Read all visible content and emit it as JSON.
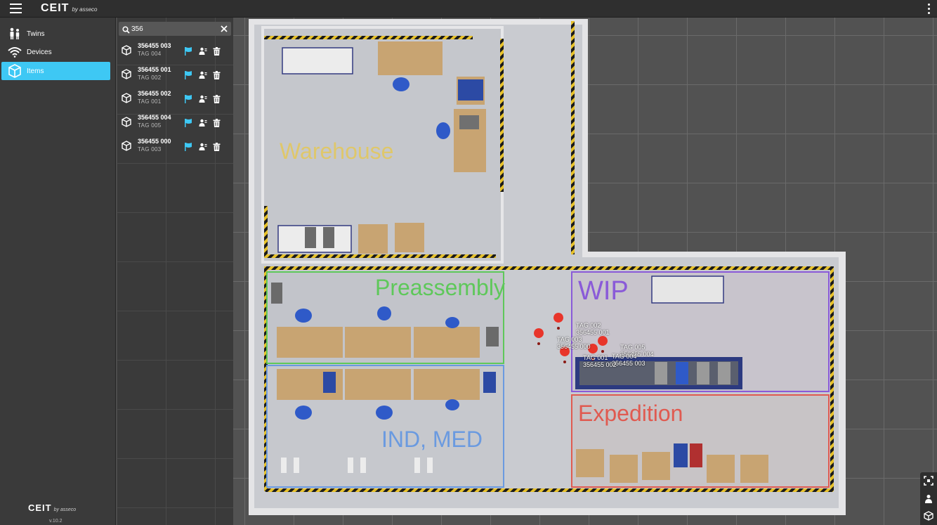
{
  "app": {
    "brand": "CEIT",
    "brand_sub": "by asseco",
    "version": "v.10.2"
  },
  "nav": [
    {
      "label": "Twins",
      "icon": "people-icon",
      "active": false
    },
    {
      "label": "Devices",
      "icon": "wifi-icon",
      "active": false
    },
    {
      "label": "Items",
      "icon": "cube-icon",
      "active": true
    }
  ],
  "search": {
    "value": "356",
    "placeholder": ""
  },
  "items": [
    {
      "title": "356455 003",
      "tag": "TAG 004"
    },
    {
      "title": "356455 001",
      "tag": "TAG 002"
    },
    {
      "title": "356455 002",
      "tag": "TAG 001"
    },
    {
      "title": "356455 004",
      "tag": "TAG 005"
    },
    {
      "title": "356455 000",
      "tag": "TAG 003"
    }
  ],
  "zones": {
    "warehouse": "Warehouse",
    "preassembly": "Preassembly",
    "wip": "WIP",
    "expedition": "Expedition",
    "ind_med": "IND, MED"
  },
  "zone_colors": {
    "warehouse": "#e8c84a",
    "preassembly": "#5ec85a",
    "wip": "#8a5ad8",
    "expedition": "#e05a50",
    "ind_med": "#6a9ae0"
  },
  "map_tags": [
    {
      "tag": "TAG 002",
      "id": "356455 001"
    },
    {
      "tag": "TAG 003",
      "id": "356455 000"
    },
    {
      "tag": "TAG 005",
      "id": "356455 004"
    },
    {
      "tag": "TAG 004",
      "id": "356455 003"
    },
    {
      "tag": "TAG 001",
      "id": "356455 002"
    }
  ],
  "accent_color": "#3ec8f4",
  "marker_color": "#e8352a"
}
